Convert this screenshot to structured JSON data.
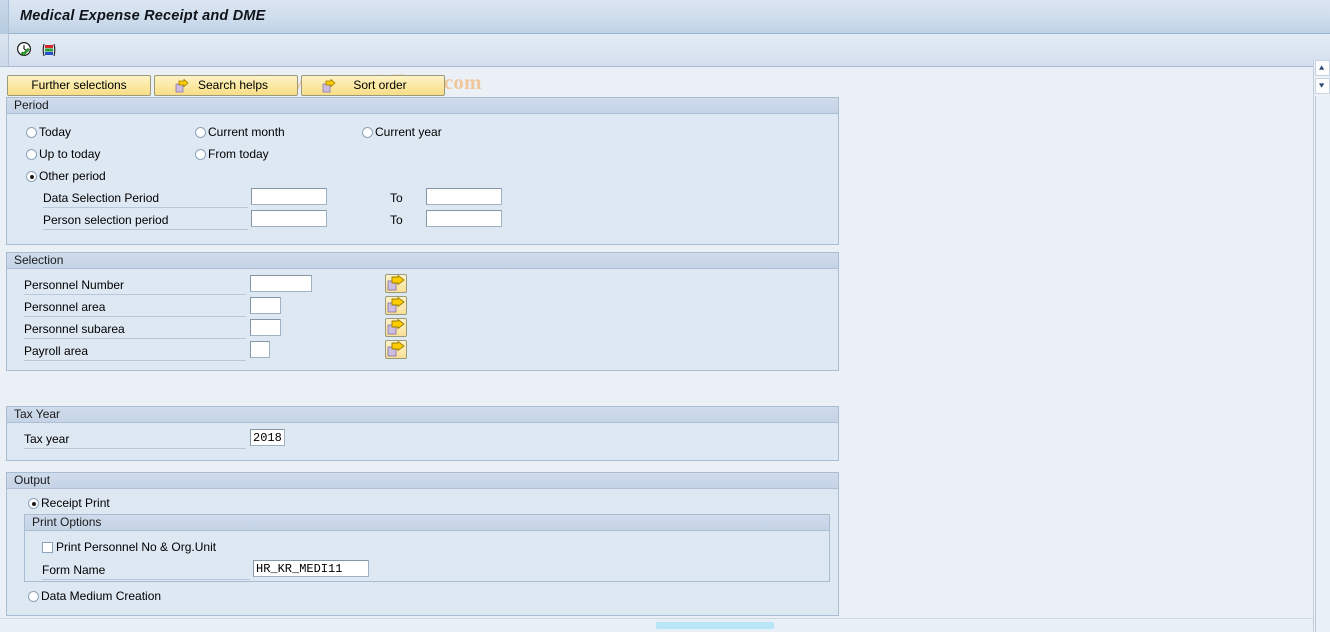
{
  "window": {
    "title": "Medical Expense Receipt and DME"
  },
  "watermark": {
    "text": "© www.tutorialkart.com"
  },
  "toolbar": {
    "icons": [
      {
        "name": "execute-clock-icon",
        "title": "Execute (F8)"
      },
      {
        "name": "variant-bars-icon",
        "title": "Get Variant"
      }
    ]
  },
  "buttons": [
    {
      "label": "Further selections",
      "icon": "none"
    },
    {
      "label": "Search helps",
      "icon": "arrow-page-icon"
    },
    {
      "label": "Sort order",
      "icon": "arrow-page-icon"
    }
  ],
  "period": {
    "title": "Period",
    "options": [
      {
        "label": "Today",
        "selected": false
      },
      {
        "label": "Current month",
        "selected": false
      },
      {
        "label": "Current year",
        "selected": false
      },
      {
        "label": "Up to today",
        "selected": false
      },
      {
        "label": "From today",
        "selected": false
      },
      {
        "label": "Other period",
        "selected": true
      }
    ],
    "rows": [
      {
        "label": "Data Selection Period",
        "from_value": "",
        "to_label": "To",
        "to_value": ""
      },
      {
        "label": "Person selection period",
        "from_value": "",
        "to_label": "To",
        "to_value": ""
      }
    ]
  },
  "selection": {
    "title": "Selection",
    "rows": [
      {
        "label": "Personnel Number",
        "value": "",
        "field_width": 62,
        "has_multi": true
      },
      {
        "label": "Personnel area",
        "value": "",
        "field_width": 31,
        "has_multi": true
      },
      {
        "label": "Personnel subarea",
        "value": "",
        "field_width": 31,
        "has_multi": true
      },
      {
        "label": "Payroll area",
        "value": "",
        "field_width": 20,
        "has_multi": true
      }
    ],
    "multi_icon": "arrow-page-icon"
  },
  "tax_year": {
    "title": "Tax Year",
    "label": "Tax year",
    "value": "2018"
  },
  "output": {
    "title": "Output",
    "receipt_print": {
      "label": "Receipt Print",
      "selected": true
    },
    "print_options": {
      "title": "Print Options",
      "checkbox": {
        "label": "Print Personnel No & Org.Unit",
        "checked": false
      },
      "form_name": {
        "label": "Form Name",
        "value": "HR_KR_MEDI11"
      }
    },
    "data_medium": {
      "label": "Data Medium Creation",
      "selected": false
    }
  },
  "scrollbars": {
    "vertical": {
      "up_icon": "scroll-up-icon",
      "down_icon": "scroll-down-icon"
    },
    "horizontal": {
      "thumb_visible": true
    }
  },
  "colors": {
    "accent": "#f7dd88",
    "panel": "#dde8f3",
    "header": "#c4d3e6",
    "watermark": "#f0c69a"
  }
}
